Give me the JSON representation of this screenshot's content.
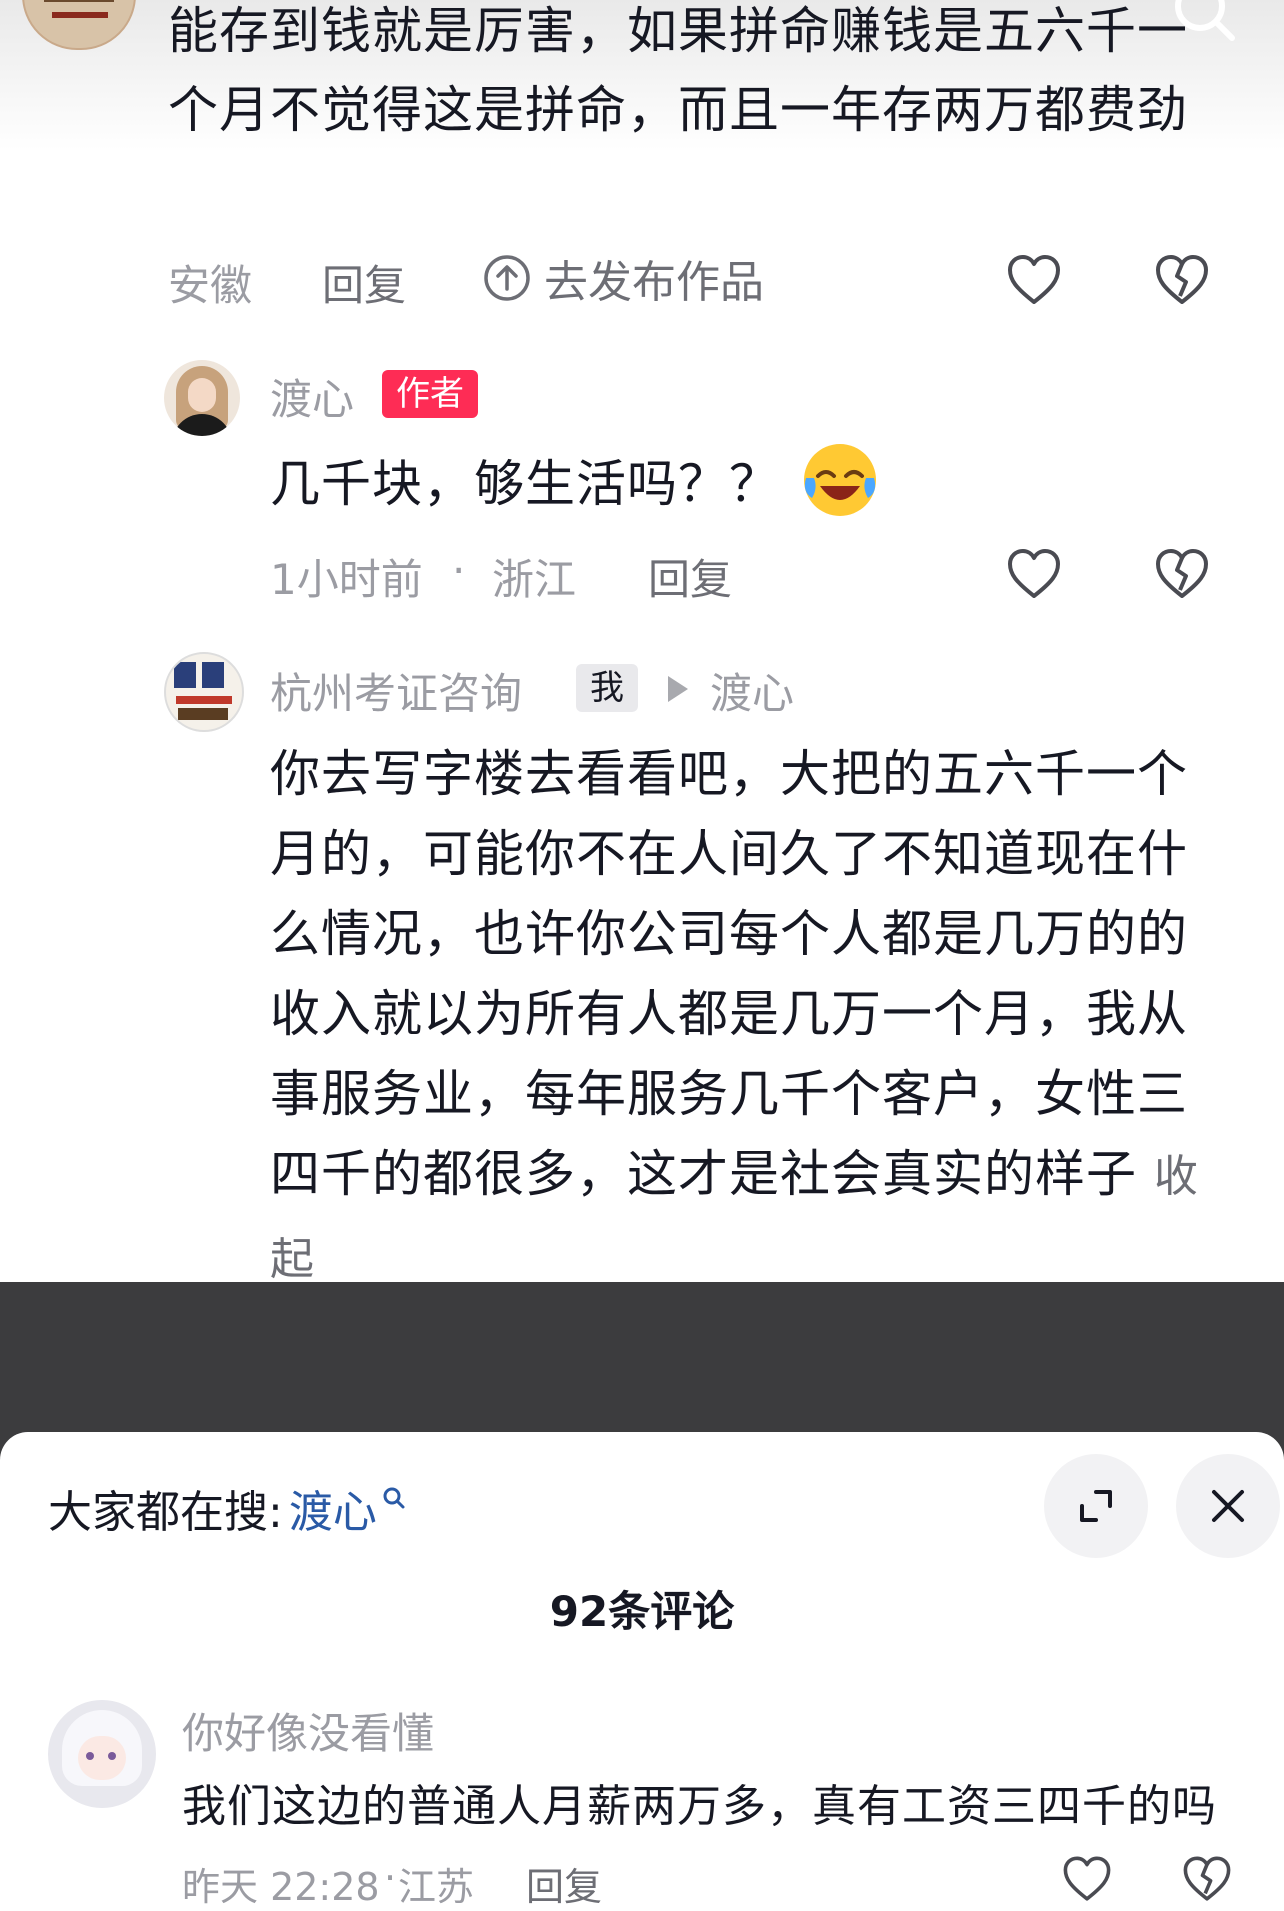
{
  "search_icon": "search-icon",
  "comments": [
    {
      "body": "能存到钱就是厉害，如果拼命赚钱是五六千一个月不觉得这是拼命，而且一年存两万都费劲",
      "location": "安徽",
      "reply_label": "回复",
      "publish_label": "去发布作品"
    },
    {
      "username": "渡心",
      "badge": "作者",
      "body": "几千块，够生活吗？？",
      "emoji": "😂",
      "time": "1小时前",
      "separator": "·",
      "location": "浙江",
      "reply_label": "回复"
    },
    {
      "username": "杭州考证咨询",
      "me_badge": "我",
      "reply_to": "渡心",
      "body": "你去写字楼去看看吧，大把的五六千一个月的，可能你不在人间久了不知道现在什么情况，也许你公司每个人都是几万的的收入就以为所有人都是几万一个月，我从事服务业，每年服务几千个客户，女性三四千的都很多，这才是社会真实的样子",
      "collapse_label": "收起"
    }
  ],
  "sheet": {
    "search_prefix": "大家都在搜:",
    "search_term": "渡心",
    "comment_count": "92条评论",
    "comment": {
      "username": "你好像没看懂",
      "body": "我们这边的普通人月薪两万多，真有工资三四千的吗",
      "time": "昨天 22:28",
      "separator": "·",
      "location": "江苏",
      "reply_label": "回复"
    }
  },
  "colors": {
    "badge_red": "#fe2c55",
    "link_blue": "#2a5aa6",
    "meta_gray": "#9b9ca3",
    "dark_band": "#3c3c3e"
  }
}
